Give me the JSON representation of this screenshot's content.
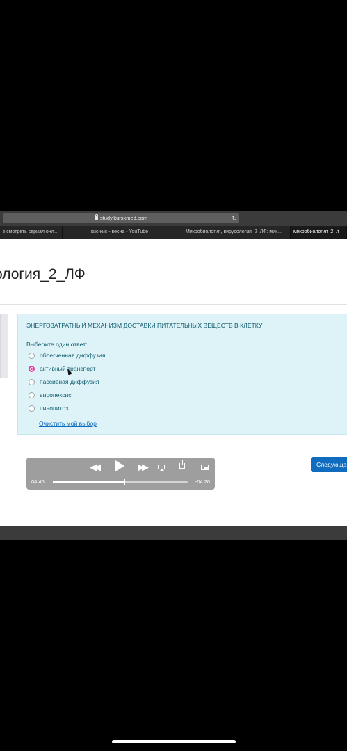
{
  "browser": {
    "url": "study.kurskmed.com",
    "tabs": [
      {
        "label": "з смотреть сериал онла..."
      },
      {
        "label": "кис-кис - весна - YouTube"
      },
      {
        "label": "Микробиология, вирусология_2_ЛФ: мик..."
      },
      {
        "label": "микробиология_2_л"
      }
    ]
  },
  "page": {
    "title": "ология_2_ЛФ"
  },
  "question": {
    "text": "ЭНЕРГОЗАТРАТНЫЙ МЕХАНИЗМ ДОСТАВКИ ПИТАТЕЛЬНЫХ ВЕЩЕСТВ В КЛЕТКУ",
    "prompt": "Выберите один ответ:",
    "options": [
      {
        "label": "облегченная диффузия",
        "selected": false
      },
      {
        "label": "активный транспорт",
        "selected": true
      },
      {
        "label": "пассивная диффузия",
        "selected": false
      },
      {
        "label": "виропексис",
        "selected": false
      },
      {
        "label": "пиноцитоз",
        "selected": false
      }
    ],
    "clear_label": "Очистить мой выбор"
  },
  "navigation": {
    "next_label": "Следующа"
  },
  "player": {
    "elapsed": "04:46",
    "remaining": "-04:20",
    "progress": 0.53
  },
  "colors": {
    "accent": "#0f6cbf",
    "question_bg": "#def3f8",
    "selected_radio": "#e33ba3"
  }
}
